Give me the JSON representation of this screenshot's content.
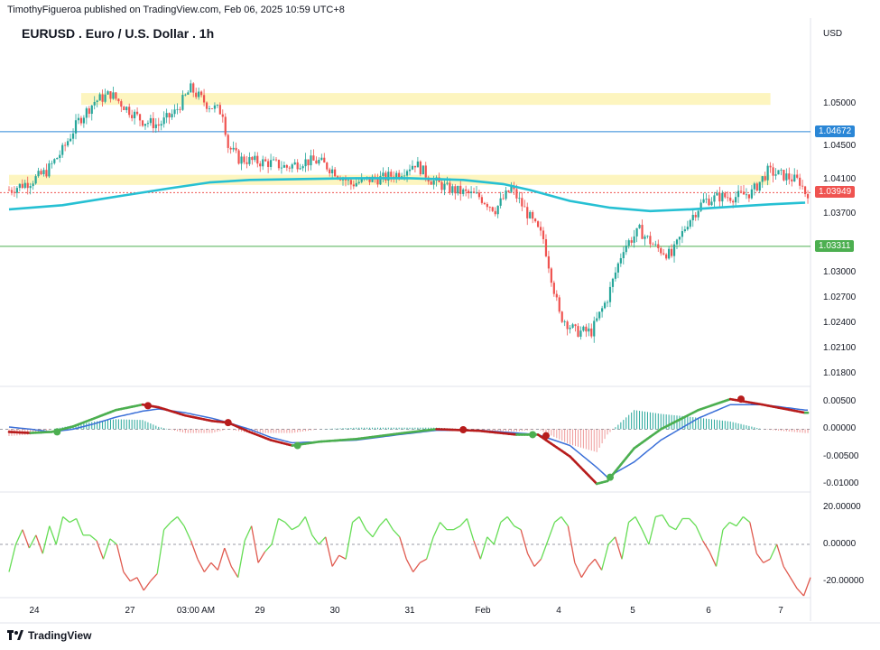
{
  "header": {
    "published": "TimothyFigueroa published on TradingView.com, Feb 06, 2025 10:59 UTC+8",
    "symbol": "EURUSD . Euro / U.S. Dollar . 1h",
    "currency": "USD"
  },
  "footer": {
    "brand": "TradingView",
    "logo_icon": "tradingview-logo-icon"
  },
  "colors": {
    "up": "#26a69a",
    "down": "#ef5350",
    "ma": "#26c0d3",
    "zone": "#fdf3b4",
    "res_line": "#2a86d6",
    "sup_line": "#4caf50",
    "cur_line": "#ef5350",
    "macd_fast_up": "#4caf50",
    "macd_fast_down": "#b71c1c",
    "macd_slow": "#3a6fd8",
    "osc_up": "#66dd55",
    "osc_down": "#e05a4f"
  },
  "chart_data": [
    {
      "type": "candlestick",
      "title": "EURUSD . Euro / U.S. Dollar . 1h",
      "ylim": [
        1.0165,
        1.0572
      ],
      "y_ticks": [
        "1.05000",
        "1.04500",
        "1.04100",
        "1.03700",
        "1.03000",
        "1.02700",
        "1.02400",
        "1.02100",
        "1.01800"
      ],
      "x_ticks": [
        "24",
        "27",
        "03:00 AM",
        "29",
        "30",
        "31",
        "Feb",
        "4",
        "5",
        "6",
        "7"
      ],
      "price_lines": [
        {
          "name": "resistance",
          "value": 1.04672,
          "label": "1.04672"
        },
        {
          "name": "current",
          "value": 1.03949,
          "label": "1.03949"
        },
        {
          "name": "support",
          "value": 1.03311,
          "label": "1.03311"
        }
      ],
      "zones": [
        {
          "y": [
            1.0499,
            1.0513
          ],
          "x_range": [
            0.09,
            0.95
          ]
        },
        {
          "y": [
            1.0404,
            1.0416
          ],
          "x_range": [
            0.0,
            0.95
          ]
        }
      ],
      "close_path": [
        [
          0,
          1.0398
        ],
        [
          8,
          1.0408
        ],
        [
          14,
          1.042
        ],
        [
          20,
          1.0445
        ],
        [
          26,
          1.048
        ],
        [
          32,
          1.0503
        ],
        [
          38,
          1.0512
        ],
        [
          44,
          1.0495
        ],
        [
          50,
          1.048
        ],
        [
          56,
          1.0475
        ],
        [
          62,
          1.049
        ],
        [
          68,
          1.0518
        ],
        [
          74,
          1.05
        ],
        [
          80,
          1.049
        ],
        [
          82,
          1.045
        ],
        [
          86,
          1.0435
        ],
        [
          92,
          1.0432
        ],
        [
          98,
          1.043
        ],
        [
          104,
          1.0425
        ],
        [
          110,
          1.0432
        ],
        [
          116,
          1.0432
        ],
        [
          122,
          1.042
        ],
        [
          128,
          1.0405
        ],
        [
          134,
          1.041
        ],
        [
          140,
          1.0412
        ],
        [
          146,
          1.0418
        ],
        [
          152,
          1.043
        ],
        [
          158,
          1.041
        ],
        [
          164,
          1.04
        ],
        [
          170,
          1.0395
        ],
        [
          176,
          1.039
        ],
        [
          182,
          1.0375
        ],
        [
          188,
          1.04
        ],
        [
          194,
          1.037
        ],
        [
          200,
          1.034
        ],
        [
          206,
          1.025
        ],
        [
          212,
          1.023
        ],
        [
          218,
          1.023
        ],
        [
          224,
          1.027
        ],
        [
          230,
          1.033
        ],
        [
          236,
          1.035
        ],
        [
          242,
          1.033
        ],
        [
          248,
          1.032
        ],
        [
          254,
          1.036
        ],
        [
          260,
          1.0385
        ],
        [
          266,
          1.039
        ],
        [
          272,
          1.039
        ],
        [
          278,
          1.0395
        ],
        [
          284,
          1.042
        ],
        [
          290,
          1.0415
        ],
        [
          296,
          1.0408
        ],
        [
          298,
          1.0395
        ]
      ],
      "moving_average": [
        [
          0,
          1.0375
        ],
        [
          20,
          1.038
        ],
        [
          40,
          1.039
        ],
        [
          60,
          1.04
        ],
        [
          75,
          1.0407
        ],
        [
          90,
          1.041
        ],
        [
          110,
          1.0411
        ],
        [
          130,
          1.0412
        ],
        [
          150,
          1.0412
        ],
        [
          170,
          1.041
        ],
        [
          185,
          1.0405
        ],
        [
          195,
          1.0398
        ],
        [
          210,
          1.0385
        ],
        [
          225,
          1.0377
        ],
        [
          240,
          1.0373
        ],
        [
          255,
          1.0375
        ],
        [
          270,
          1.0378
        ],
        [
          285,
          1.0381
        ],
        [
          298,
          1.0383
        ]
      ]
    },
    {
      "type": "line",
      "name": "macd",
      "ylim": [
        -0.0115,
        0.0075
      ],
      "y_ticks": [
        "0.00500",
        "0.00000",
        "-0.00500",
        "-0.01000"
      ],
      "fast": [
        [
          0,
          -0.0005
        ],
        [
          8,
          -0.0007
        ],
        [
          16,
          -0.0005
        ],
        [
          24,
          0.0005
        ],
        [
          32,
          0.002
        ],
        [
          40,
          0.0035
        ],
        [
          50,
          0.0045
        ],
        [
          56,
          0.004
        ],
        [
          66,
          0.0025
        ],
        [
          76,
          0.0015
        ],
        [
          82,
          0.0012
        ],
        [
          90,
          -0.0005
        ],
        [
          98,
          -0.002
        ],
        [
          106,
          -0.003
        ],
        [
          116,
          -0.0023
        ],
        [
          130,
          -0.0018
        ],
        [
          146,
          -0.0008
        ],
        [
          160,
          0.0
        ],
        [
          176,
          -0.0003
        ],
        [
          190,
          -0.001
        ],
        [
          198,
          -0.001
        ],
        [
          210,
          -0.005
        ],
        [
          220,
          -0.01
        ],
        [
          224,
          -0.0095
        ],
        [
          234,
          -0.0035
        ],
        [
          244,
          0.0
        ],
        [
          258,
          0.0035
        ],
        [
          270,
          0.0055
        ],
        [
          282,
          0.0045
        ],
        [
          298,
          0.003
        ]
      ],
      "slow": [
        [
          0,
          0.0004
        ],
        [
          8,
          0.0
        ],
        [
          16,
          -0.0005
        ],
        [
          24,
          0.0
        ],
        [
          32,
          0.001
        ],
        [
          40,
          0.0022
        ],
        [
          50,
          0.0033
        ],
        [
          56,
          0.0037
        ],
        [
          66,
          0.003
        ],
        [
          76,
          0.002
        ],
        [
          82,
          0.0012
        ],
        [
          90,
          0.0
        ],
        [
          98,
          -0.0015
        ],
        [
          106,
          -0.0025
        ],
        [
          116,
          -0.0023
        ],
        [
          130,
          -0.002
        ],
        [
          146,
          -0.001
        ],
        [
          160,
          -0.0002
        ],
        [
          176,
          -0.0002
        ],
        [
          190,
          -0.0007
        ],
        [
          198,
          -0.001
        ],
        [
          210,
          -0.003
        ],
        [
          220,
          -0.007
        ],
        [
          224,
          -0.0088
        ],
        [
          234,
          -0.006
        ],
        [
          244,
          -0.002
        ],
        [
          258,
          0.002
        ],
        [
          270,
          0.0045
        ],
        [
          282,
          0.0045
        ],
        [
          298,
          0.0035
        ]
      ],
      "signals": [
        {
          "x": 18,
          "v": -0.0005,
          "kind": "buy"
        },
        {
          "x": 52,
          "v": 0.0043,
          "kind": "sell"
        },
        {
          "x": 82,
          "v": 0.0012,
          "kind": "sell"
        },
        {
          "x": 108,
          "v": -0.003,
          "kind": "buy"
        },
        {
          "x": 170,
          "v": -0.0001,
          "kind": "sell"
        },
        {
          "x": 196,
          "v": -0.001,
          "kind": "buy"
        },
        {
          "x": 201,
          "v": -0.0012,
          "kind": "sell"
        },
        {
          "x": 225,
          "v": -0.0088,
          "kind": "buy"
        },
        {
          "x": 274,
          "v": 0.0055,
          "kind": "sell"
        }
      ]
    },
    {
      "type": "line",
      "name": "oscillator",
      "ylim": [
        -28,
        27
      ],
      "y_ticks": [
        "20.00000",
        "0.00000",
        "-20.00000"
      ],
      "values": [
        -15,
        0,
        8,
        -2,
        5,
        -5,
        10,
        0,
        15,
        12,
        14,
        5,
        5,
        2,
        -8,
        3,
        0,
        -15,
        -20,
        -18,
        -25,
        -20,
        -16,
        8,
        12,
        15,
        10,
        2,
        -8,
        -15,
        -10,
        -14,
        -2,
        -12,
        -18,
        2,
        10,
        -10,
        -4,
        0,
        14,
        12,
        8,
        10,
        15,
        5,
        0,
        4,
        -12,
        -6,
        -8,
        12,
        15,
        8,
        4,
        10,
        14,
        8,
        4,
        -8,
        -15,
        -10,
        -8,
        4,
        12,
        8,
        8,
        10,
        14,
        2,
        -8,
        4,
        0,
        12,
        15,
        10,
        8,
        -5,
        -12,
        -8,
        2,
        12,
        15,
        10,
        -10,
        -18,
        -12,
        -8,
        -14,
        0,
        4,
        -8,
        12,
        15,
        8,
        0,
        15,
        16,
        10,
        8,
        14,
        14,
        10,
        2,
        -4,
        -12,
        8,
        12,
        10,
        15,
        12,
        -5,
        -10,
        -8,
        0,
        -12,
        -18,
        -24,
        -28,
        -18
      ]
    }
  ]
}
